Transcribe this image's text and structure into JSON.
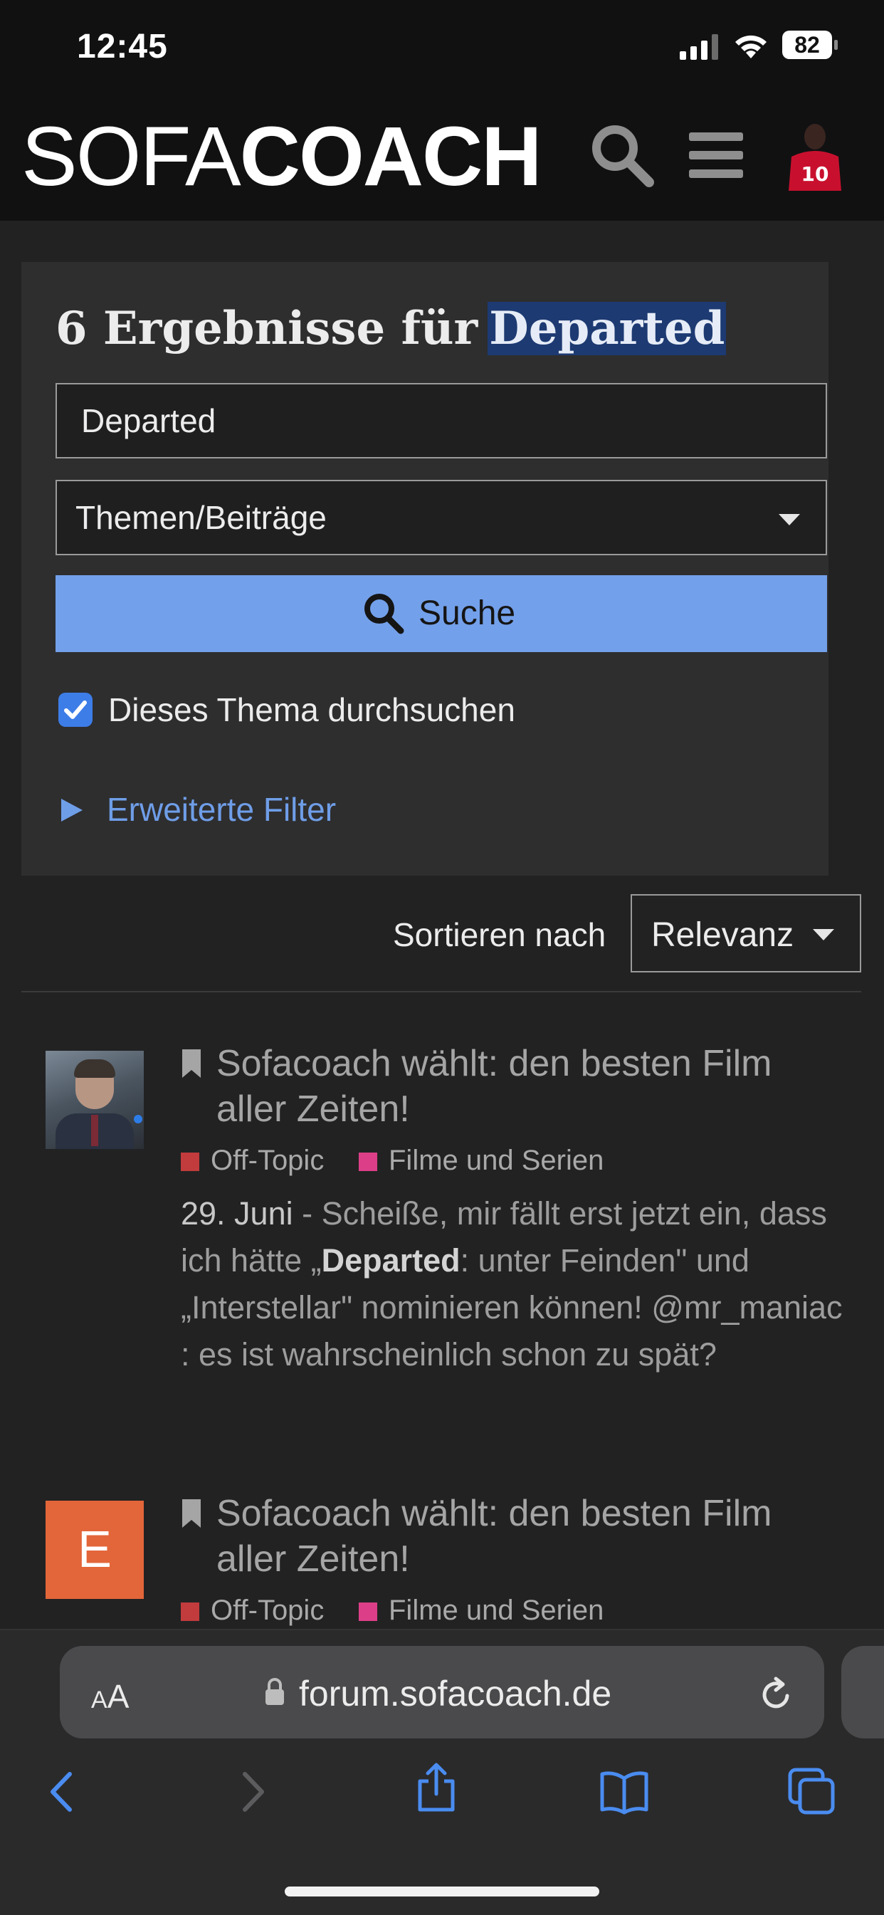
{
  "status_bar": {
    "time": "12:45",
    "battery": "82"
  },
  "header": {
    "logo_light": "SOFA",
    "logo_bold": "COACH"
  },
  "search": {
    "results_count_text": "6 Ergebnisse für",
    "query_highlight": "Departed",
    "query_value": "Departed",
    "scope_value": "Themen/Beiträge",
    "submit_label": "Suche",
    "checkbox_label": "Dieses Thema durchsuchen",
    "checkbox_checked": true,
    "advanced_filter_label": "Erweiterte Filter"
  },
  "sort": {
    "label": "Sortieren nach",
    "value": "Relevanz"
  },
  "results": [
    {
      "title_line1": "Sofacoach wählt: den besten Film",
      "title_line2": "aller Zeiten!",
      "tags": [
        "Off-Topic",
        "Filme und Serien"
      ],
      "date": "29. Juni",
      "snippet_sep": " - ",
      "snippet_a": "Scheiße, mir fällt erst jetzt ein, dass ich hätte „",
      "snippet_highlight": "Departed",
      "snippet_b": ": unter Feinden\" und „Interstellar\" nominieren können! @mr_maniac : es ist wahrscheinlich schon zu spät?"
    },
    {
      "avatar_letter": "E",
      "title_line1": "Sofacoach wählt: den besten Film",
      "title_line2": "aller Zeiten!",
      "tags": [
        "Off-Topic",
        "Filme und Serien"
      ]
    }
  ],
  "browser": {
    "text_size_label_small": "A",
    "text_size_label_large": "A",
    "url": "forum.sofacoach.de"
  },
  "colors": {
    "accent_blue": "#73a0ea",
    "link_blue": "#6f9ee8",
    "highlight_bg": "#1d3a72",
    "tag_offtopic": "#c23b3d",
    "tag_filme": "#dc3f87",
    "avatar_e": "#e3663a"
  }
}
